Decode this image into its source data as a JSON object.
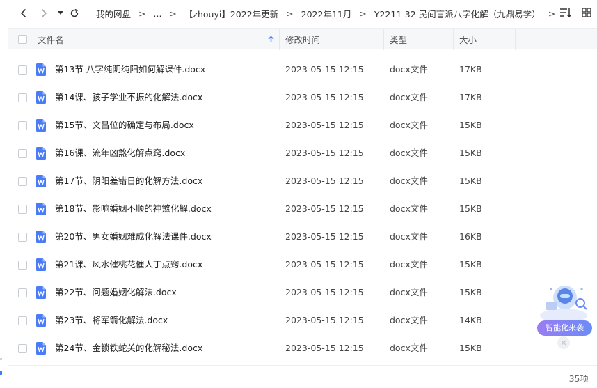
{
  "breadcrumb": {
    "items": [
      "我的网盘",
      "...",
      "【zhouyi】2022年更新",
      "2022年11月",
      "Y2211-32 民间盲派八字化解（九鼎易学）"
    ],
    "separator": ">"
  },
  "columns": {
    "name": "文件名",
    "modified": "修改时间",
    "type": "类型",
    "size": "大小"
  },
  "files": [
    {
      "name": "第13节 八字纯阴纯阳如何解课件.docx",
      "modified": "2023-05-15 12:15",
      "type": "docx文件",
      "size": "17KB"
    },
    {
      "name": "第14课、孩子学业不振的化解法.docx",
      "modified": "2023-05-15 12:15",
      "type": "docx文件",
      "size": "17KB"
    },
    {
      "name": "第15节、文昌位的确定与布局.docx",
      "modified": "2023-05-15 12:15",
      "type": "docx文件",
      "size": "15KB"
    },
    {
      "name": "第16课、流年凶煞化解点窍.docx",
      "modified": "2023-05-15 12:15",
      "type": "docx文件",
      "size": "15KB"
    },
    {
      "name": "第17节、阴阳差错日的化解方法.docx",
      "modified": "2023-05-15 12:15",
      "type": "docx文件",
      "size": "15KB"
    },
    {
      "name": "第18节、影响婚姻不顺的神煞化解.docx",
      "modified": "2023-05-15 12:15",
      "type": "docx文件",
      "size": "15KB"
    },
    {
      "name": "第20节、男女婚姻难成化解法课件.docx",
      "modified": "2023-05-15 12:15",
      "type": "docx文件",
      "size": "16KB"
    },
    {
      "name": "第21课、风水催桃花催人丁点窍.docx",
      "modified": "2023-05-15 12:15",
      "type": "docx文件",
      "size": "15KB"
    },
    {
      "name": "第22节、问题婚姻化解法.docx",
      "modified": "2023-05-15 12:15",
      "type": "docx文件",
      "size": "15KB"
    },
    {
      "name": "第23节、将军箭化解法.docx",
      "modified": "2023-05-15 12:15",
      "type": "docx文件",
      "size": "14KB"
    },
    {
      "name": "第24节、金锁铁蛇关的化解秘法.docx",
      "modified": "2023-05-15 12:15",
      "type": "docx文件",
      "size": "15KB"
    }
  ],
  "footer": {
    "count": "35项"
  },
  "ai_widget": {
    "label": "智能化来袭"
  },
  "colors": {
    "doc_icon": "#4a7cf7",
    "accent": "#3e7bfa"
  },
  "icons": {
    "back": "chevron-left-icon",
    "forward": "chevron-right-icon",
    "history": "caret-down-icon",
    "refresh": "refresh-icon",
    "sort": "sort-icon",
    "grid": "grid-icon",
    "sort_dir": "arrow-up-icon",
    "file": "word-doc-icon"
  }
}
